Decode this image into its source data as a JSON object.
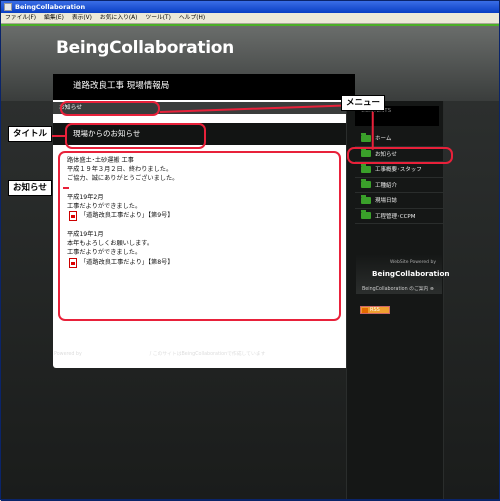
{
  "window": {
    "title": "BeingCollaboration"
  },
  "menubar": {
    "items": [
      "ファイル(F)",
      "編集(E)",
      "表示(V)",
      "お気に入り(A)",
      "ツール(T)",
      "ヘルプ(H)"
    ]
  },
  "site": {
    "logo": "BeingCollaboration",
    "title": "道路改良工事 現場情報局",
    "breadcrumb": "お知らせ",
    "section_title": "現場からのお知らせ"
  },
  "content": {
    "block1": {
      "line1": "路体盛土･土砂運搬 工事",
      "line2": "平成１９年３月２日、終わりました。",
      "line3": "ご協力、誠にありがとうございました。"
    },
    "block2": {
      "line1": "平成19年2月",
      "line2": "工事だよりができました。",
      "pdf": "「道路改良工事だより」【第9号】"
    },
    "block3": {
      "line1": "平成19年1月",
      "line2": "本年もよろしくお願いします。",
      "line3": "工事だよりができました。",
      "pdf": "「道路改良工事だより」【第8号】"
    }
  },
  "sidebar": {
    "header_text": "CONTENTS",
    "items": [
      "ホーム",
      "お知らせ",
      "工事概要･スタッフ",
      "工種紹介",
      "現場日誌",
      "工程管理･CCPM"
    ],
    "powered": {
      "small": "WebSite Powered by",
      "big": "BeingCollaboration",
      "link": "BeingCollaboration のご案内 ⊕"
    },
    "rss": "RSS"
  },
  "footer": {
    "prefix": "Powered by",
    "brand": "BeingCollaboration",
    "suffix": "/ このサイトはBeingCollaborationで作成しています"
  },
  "callouts": {
    "menu": "メニュー",
    "title": "タイトル",
    "notice": "お知らせ"
  },
  "colors": {
    "annotation": "#e8213a",
    "folder": "#3aa02a"
  },
  "icons": [
    "app-icon",
    "pdf-icon",
    "folder-icon",
    "rss-icon"
  ]
}
